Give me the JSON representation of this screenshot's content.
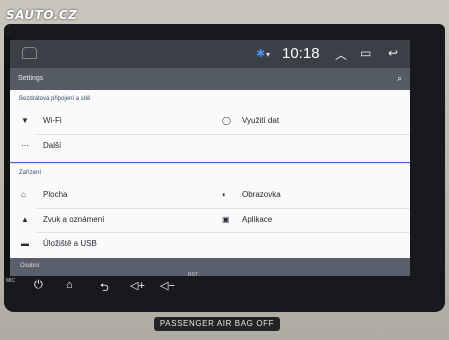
{
  "watermark": "SAUTO.CZ",
  "status_bar": {
    "time": "10:18",
    "icons": [
      "bluetooth-icon",
      "signal-dot-icon",
      "chevron-up-icon",
      "recent-apps-icon",
      "back-icon"
    ]
  },
  "app_bar": {
    "title": "Settings",
    "search_icon": "search-icon"
  },
  "sections": [
    {
      "title": "Bezdrátová připojení a sítě",
      "rows": [
        {
          "icon": "wifi-icon",
          "label": "Wi-Fi",
          "icon2": "data-usage-icon",
          "label2": "Využití dat"
        },
        {
          "icon": "more-icon",
          "label": "Další"
        }
      ]
    },
    {
      "title": "Zařízení",
      "rows": [
        {
          "icon": "home-icon",
          "label": "Plocha",
          "icon2": "display-icon",
          "label2": "Obrazovka"
        },
        {
          "icon": "bell-icon",
          "label": "Zvuk a oznámení",
          "icon2": "android-icon",
          "label2": "Aplikace"
        },
        {
          "icon": "storage-icon",
          "label": "Úložiště a USB"
        }
      ]
    }
  ],
  "osobni_title": "Osobní",
  "hardware": {
    "mic_label": "MIC",
    "buttons": [
      "power-icon",
      "home-icon",
      "back-icon",
      "volume-up-icon",
      "volume-down-icon"
    ],
    "rst_label": "RST"
  },
  "airbag_label": "PASSENGER AIR BAG OFF"
}
